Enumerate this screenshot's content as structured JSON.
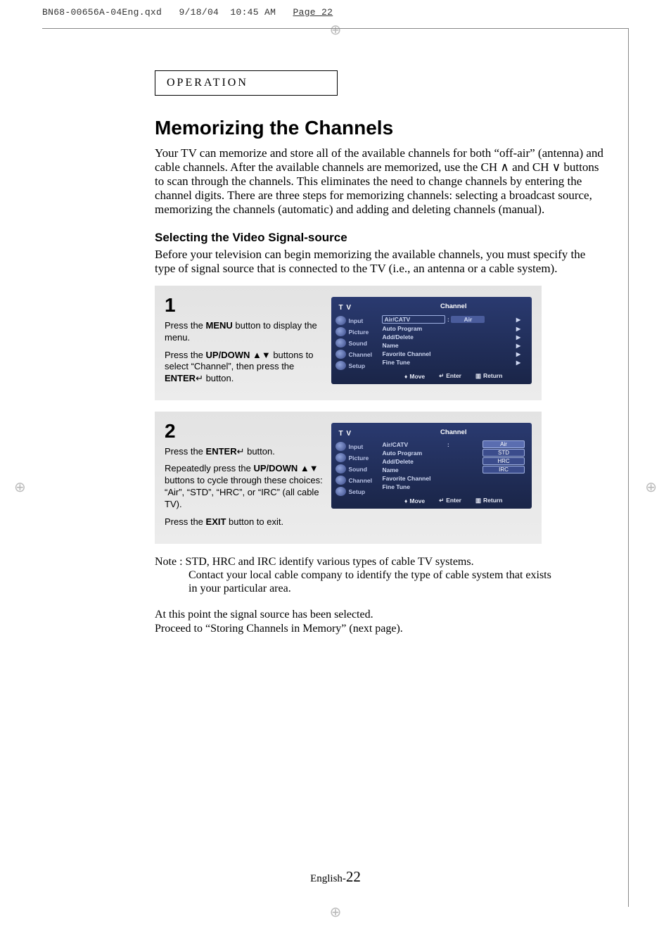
{
  "print_header": {
    "file": "BN68-00656A-04Eng.qxd",
    "date": "9/18/04",
    "time": "10:45 AM",
    "page_label": "Page 22"
  },
  "section_label": "OPERATION",
  "title": "Memorizing the Channels",
  "intro": "Your TV can memorize and store all of the available channels for both “off-air” (antenna) and cable channels. After the available channels are memorized, use the CH ∧ and CH ∨ buttons to scan through the channels. This eliminates the need to change channels by entering the channel digits. There are three steps for memorizing channels: selecting a broadcast source, memorizing the channels (automatic) and adding and deleting channels (manual).",
  "subhead": "Selecting the Video Signal-source",
  "subintro": "Before your television can begin memorizing the available channels, you must specify the type of signal source that is connected to the TV (i.e., an antenna or a cable system).",
  "steps": [
    {
      "num": "1",
      "p1_a": "Press the ",
      "p1_b": "MENU",
      "p1_c": " button to display the menu.",
      "p2_a": "Press the ",
      "p2_b": "UP/DOWN",
      "p2_c": " ▲▼ buttons to select “Channel”, then press the ",
      "p2_d": "ENTER",
      "p2_e": "↵ button."
    },
    {
      "num": "2",
      "p1_a": "Press the ",
      "p1_b": "ENTER",
      "p1_c": "↵ button.",
      "p2_a": "Repeatedly press the ",
      "p2_b": "UP/DOWN",
      "p2_c": " ▲▼ buttons to cycle through these choices: “Air”, “STD”, “HRC”, or “IRC” (all cable TV).",
      "p3_a": "Press the ",
      "p3_b": "EXIT",
      "p3_c": " button to exit."
    }
  ],
  "osd": {
    "tv_label": "T V",
    "heading": "Channel",
    "side": [
      "Input",
      "Picture",
      "Sound",
      "Channel",
      "Setup"
    ],
    "menu_items": [
      "Air/CATV",
      "Auto Program",
      "Add/Delete",
      "Name",
      "Favorite Channel",
      "Fine Tune"
    ],
    "value_air": "Air",
    "options": [
      "Air",
      "STD",
      "HRC",
      "IRC"
    ],
    "footer": {
      "move": "Move",
      "enter": "Enter",
      "return": "Return"
    }
  },
  "note_prefix": "Note : ",
  "note_line1": "STD, HRC and IRC identify various types of cable TV systems.",
  "note_line2": "Contact your local cable company to identify the type of cable system that exists in your particular area.",
  "closing_1": "At this point the signal source has been selected.",
  "closing_2": "Proceed to “Storing Channels in Memory” (next page).",
  "page_footer_lang": "English-",
  "page_footer_num": "22"
}
